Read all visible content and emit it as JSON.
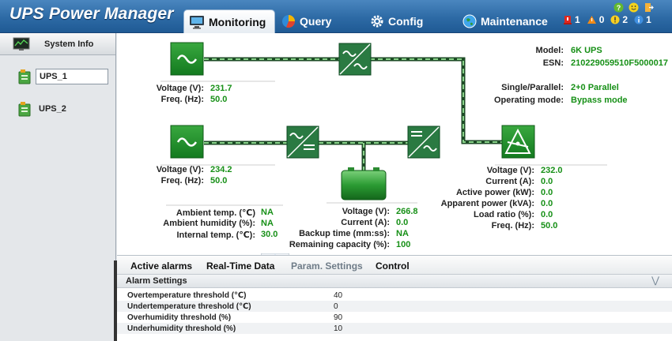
{
  "app": {
    "title": "UPS Power Manager"
  },
  "tabs": [
    {
      "label": "Monitoring",
      "icon": "monitor-icon",
      "active": true
    },
    {
      "label": "Query",
      "icon": "pie-chart-icon"
    },
    {
      "label": "Config",
      "icon": "gear-icon"
    },
    {
      "label": "Maintenance",
      "icon": "globe-icon"
    }
  ],
  "alarms": {
    "critical": "1",
    "major": "0",
    "minor": "2",
    "info": "1"
  },
  "sidebar": {
    "system_info": "System Info",
    "items": [
      {
        "label": "UPS_1",
        "selected": true
      },
      {
        "label": "UPS_2",
        "selected": false
      }
    ]
  },
  "ups_info": {
    "model_label": "Model:",
    "model": "6K UPS",
    "esn_label": "ESN:",
    "esn": "210229059510F5000017",
    "mode_label": "Single/Parallel:",
    "mode": "2+0 Parallel",
    "operating_label": "Operating mode:",
    "operating": "Bypass mode"
  },
  "bypass_input": {
    "voltage_label": "Voltage (V):",
    "voltage": "231.7",
    "freq_label": "Freq. (Hz):",
    "freq": "50.0"
  },
  "main_input": {
    "voltage_label": "Voltage (V):",
    "voltage": "234.2",
    "freq_label": "Freq. (Hz):",
    "freq": "50.0"
  },
  "environment": {
    "ambient_temp_label": "Ambient temp. (℃)",
    "ambient_temp": "NA",
    "ambient_humidity_label": "Ambient humidity (%):",
    "ambient_humidity": "NA",
    "internal_temp_label": "Internal temp. (℃):",
    "internal_temp": "30.0"
  },
  "battery": {
    "voltage_label": "Voltage (V):",
    "voltage": "266.8",
    "current_label": "Current (A):",
    "current": "0.0",
    "backup_label": "Backup time (mm:ss):",
    "backup": "NA",
    "capacity_label": "Remaining capacity (%):",
    "capacity": "100"
  },
  "output": {
    "voltage_label": "Voltage (V):",
    "voltage": "232.0",
    "current_label": "Current (A):",
    "current": "0.0",
    "active_power_label": "Active power (kW):",
    "active_power": "0.0",
    "apparent_power_label": "Apparent power (kVA):",
    "apparent_power": "0.0",
    "load_ratio_label": "Load ratio (%):",
    "load_ratio": "0.0",
    "freq_label": "Freq. (Hz):",
    "freq": "50.0"
  },
  "bottom_tabs": [
    {
      "label": "Active alarms"
    },
    {
      "label": "Real-Time Data"
    },
    {
      "label": "Param. Settings",
      "active": true
    },
    {
      "label": "Control"
    }
  ],
  "alarm_settings": {
    "title": "Alarm Settings",
    "rows": [
      {
        "name": "Overtemperature threshold (℃)",
        "value": "40"
      },
      {
        "name": "Undertemperature threshold (℃)",
        "value": "0"
      },
      {
        "name": "Overhumidity threshold (%)",
        "value": "90"
      },
      {
        "name": "Underhumidity threshold (%)",
        "value": "10"
      }
    ]
  },
  "colors": {
    "header": "#2d6aa5",
    "value_green": "#179017",
    "module_green": "#1f8a2a",
    "line_dark": "#1d4b26",
    "line_light": "#8ad38a"
  }
}
